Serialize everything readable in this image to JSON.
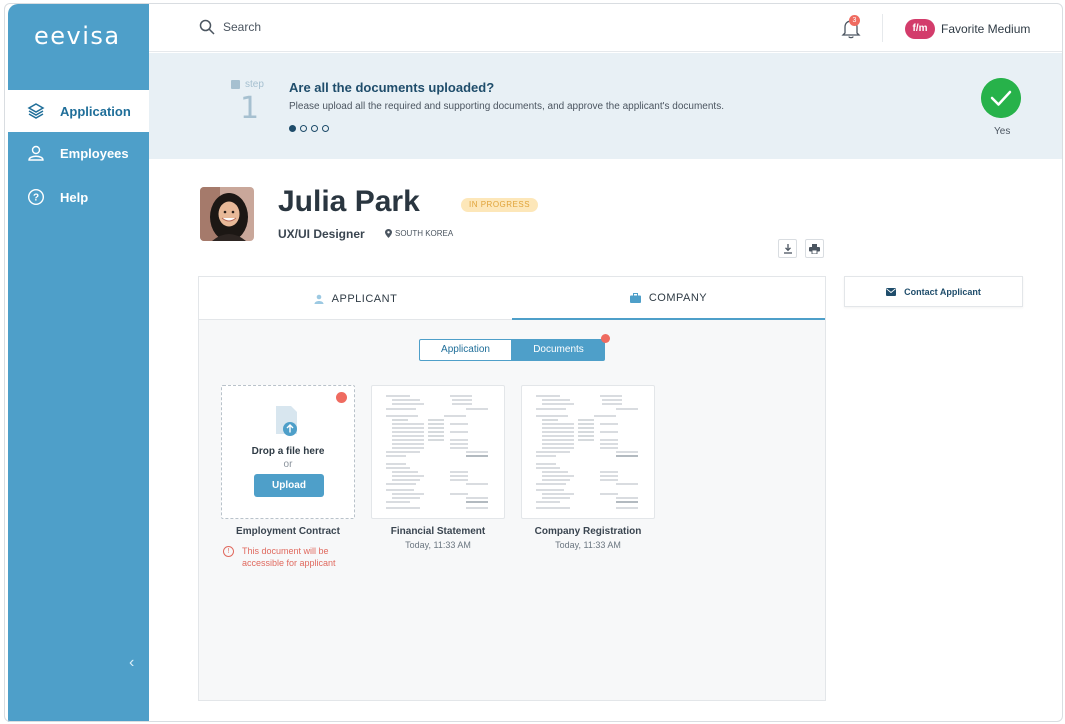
{
  "sidebar": {
    "logo": "eevisa",
    "items": [
      {
        "label": "Application",
        "icon": "layers-icon",
        "active": true
      },
      {
        "label": "Employees",
        "icon": "user-icon",
        "active": false
      },
      {
        "label": "Help",
        "icon": "help-icon",
        "active": false
      }
    ],
    "collapse_glyph": "‹"
  },
  "topbar": {
    "search_label": "Search",
    "notification_count": "3",
    "company_initials": "f/m",
    "company_name": "Favorite Medium"
  },
  "banner": {
    "step_label": "step",
    "step_number": "1",
    "title": "Are all the documents uploaded?",
    "subtitle": "Please upload all the required and supporting documents, and approve the applicant's documents.",
    "dots_total": 4,
    "dots_active": 1,
    "status_label": "Yes"
  },
  "profile": {
    "name": "Julia Park",
    "status": "IN PROGRESS",
    "role": "UX/UI Designer",
    "location": "SOUTH KOREA"
  },
  "tabs": [
    {
      "label": "APPLICANT",
      "active": false
    },
    {
      "label": "COMPANY",
      "active": true
    }
  ],
  "segment": {
    "option_1": "Application",
    "option_2": "Documents"
  },
  "contact_label": "Contact Applicant",
  "documents": [
    {
      "title": "Employment Contract",
      "drop_text": "Drop a file here",
      "or_text": "or",
      "upload_label": "Upload",
      "warning": "This document will be accessible for applicant"
    },
    {
      "title": "Financial Statement",
      "time": "Today, 11:33 AM"
    },
    {
      "title": "Company Registration",
      "time": "Today, 11:33 AM"
    }
  ],
  "colors": {
    "sidebar": "#4e9fc9",
    "accent": "#4e9fc9",
    "success": "#27b24a",
    "alert": "#ef6b60",
    "brand_company": "#d33c6b",
    "status_bg": "#fde7b9"
  }
}
